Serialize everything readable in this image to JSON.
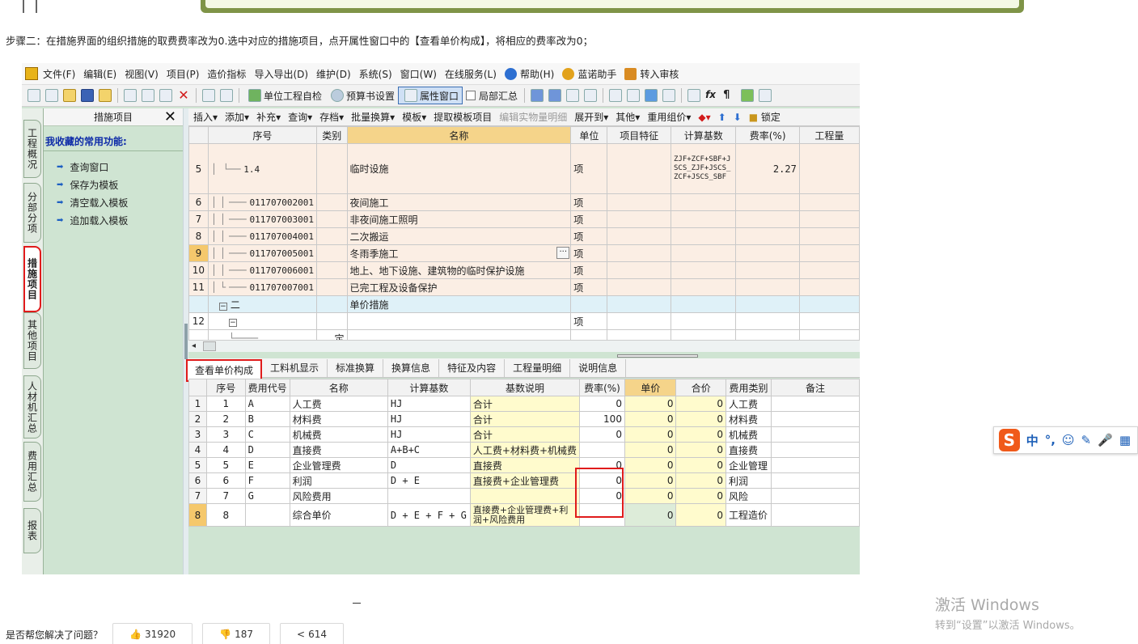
{
  "step_text": "步骤二：在措施界面的组织措施的取费费率改为0.选中对应的措施项目，点开属性窗口中的【查看单价构成】，将相应的费率改为0；",
  "menubar": [
    "文件(F)",
    "编辑(E)",
    "视图(V)",
    "项目(P)",
    "造价指标",
    "导入导出(D)",
    "维护(D)",
    "系统(S)",
    "窗口(W)",
    "在线服务(L)",
    "帮助(H)",
    "蓝诺助手",
    "转入审核"
  ],
  "toolbar": {
    "self_check": "单位工程自检",
    "budget_settings": "预算书设置",
    "property_window": "属性窗口",
    "partial_summary": "局部汇总"
  },
  "vertical_tabs": [
    "工程概况",
    "分部分项",
    "措施项目",
    "其他项目",
    "人材机汇总",
    "费用汇总",
    "报表"
  ],
  "favorites": {
    "header": "措施项目",
    "close": "✕",
    "title": "我收藏的常用功能:",
    "items": [
      "查询窗口",
      "保存为模板",
      "清空载入模板",
      "追加载入模板"
    ]
  },
  "main_toolbar": [
    "插入▾",
    "添加▾",
    "补充▾",
    "查询▾",
    "存档▾",
    "批量换算▾",
    "模板▾",
    "提取模板项目",
    "编辑实物量明细",
    "展开到▾",
    "其他▾",
    "重用组价▾",
    "锁定"
  ],
  "upper_table": {
    "headers": [
      "序号",
      "类别",
      "名称",
      "单位",
      "项目特征",
      "计算基数",
      "费率(%)",
      "工程量"
    ],
    "rows": [
      {
        "num": "5",
        "code": "1.4",
        "type": "",
        "name": "临时设施",
        "unit": "项",
        "feature": "",
        "base": "ZJF+ZCF+SBF+JSCS_ZJF+JSCS_ZCF+JSCS_SBF",
        "rate": "2.27",
        "qty": ""
      },
      {
        "num": "6",
        "code": "011707002001",
        "type": "",
        "name": "夜间施工",
        "unit": "项",
        "feature": "",
        "base": "",
        "rate": "",
        "qty": ""
      },
      {
        "num": "7",
        "code": "011707003001",
        "type": "",
        "name": "非夜间施工照明",
        "unit": "项",
        "feature": "",
        "base": "",
        "rate": "",
        "qty": ""
      },
      {
        "num": "8",
        "code": "011707004001",
        "type": "",
        "name": "二次搬运",
        "unit": "项",
        "feature": "",
        "base": "",
        "rate": "",
        "qty": ""
      },
      {
        "num": "9",
        "code": "011707005001",
        "type": "",
        "name": "冬雨季施工",
        "unit": "项",
        "feature": "",
        "base": "",
        "rate": "",
        "qty": ""
      },
      {
        "num": "10",
        "code": "011707006001",
        "type": "",
        "name": "地上、地下设施、建筑物的临时保护设施",
        "unit": "项",
        "feature": "",
        "base": "",
        "rate": "",
        "qty": ""
      },
      {
        "num": "11",
        "code": "011707007001",
        "type": "",
        "name": "已完工程及设备保护",
        "unit": "项",
        "feature": "",
        "base": "",
        "rate": "",
        "qty": ""
      },
      {
        "num": "",
        "code": "二",
        "type": "",
        "name": "单价措施",
        "unit": "",
        "feature": "",
        "base": "",
        "rate": "",
        "qty": ""
      },
      {
        "num": "12",
        "code": "",
        "type": "",
        "name": "",
        "unit": "项",
        "feature": "",
        "base": "",
        "rate": "",
        "qty": ""
      },
      {
        "num": "",
        "code": "",
        "type": "定",
        "name": "",
        "unit": "",
        "feature": "",
        "base": "",
        "rate": "",
        "qty": ""
      }
    ]
  },
  "lower_tabs": [
    "查看单价构成",
    "工料机显示",
    "标准换算",
    "换算信息",
    "特征及内容",
    "工程量明细",
    "说明信息"
  ],
  "lower_table": {
    "headers": [
      "序号",
      "费用代号",
      "名称",
      "计算基数",
      "基数说明",
      "费率(%)",
      "单价",
      "合价",
      "费用类别",
      "备注"
    ],
    "rows": [
      {
        "idx": "1",
        "seq": "1",
        "code": "A",
        "name": "人工费",
        "base": "HJ",
        "desc": "合计",
        "rate": "0",
        "price": "0",
        "total": "0",
        "category": "人工费",
        "note": ""
      },
      {
        "idx": "2",
        "seq": "2",
        "code": "B",
        "name": "材料费",
        "base": "HJ",
        "desc": "合计",
        "rate": "100",
        "price": "0",
        "total": "0",
        "category": "材料费",
        "note": ""
      },
      {
        "idx": "3",
        "seq": "3",
        "code": "C",
        "name": "机械费",
        "base": "HJ",
        "desc": "合计",
        "rate": "0",
        "price": "0",
        "total": "0",
        "category": "机械费",
        "note": ""
      },
      {
        "idx": "4",
        "seq": "4",
        "code": "D",
        "name": "直接费",
        "base": "A+B+C",
        "desc": "人工费+材料费+机械费",
        "rate": "",
        "price": "0",
        "total": "0",
        "category": "直接费",
        "note": ""
      },
      {
        "idx": "5",
        "seq": "5",
        "code": "E",
        "name": "企业管理费",
        "base": "D",
        "desc": "直接费",
        "rate": "0",
        "price": "0",
        "total": "0",
        "category": "企业管理",
        "note": ""
      },
      {
        "idx": "6",
        "seq": "6",
        "code": "F",
        "name": "利润",
        "base": "D + E",
        "desc": "直接费+企业管理费",
        "rate": "0",
        "price": "0",
        "total": "0",
        "category": "利润",
        "note": ""
      },
      {
        "idx": "7",
        "seq": "7",
        "code": "G",
        "name": "风险费用",
        "base": "",
        "desc": "",
        "rate": "0",
        "price": "0",
        "total": "0",
        "category": "风险",
        "note": ""
      },
      {
        "idx": "8",
        "seq": "8",
        "code": "",
        "name": "综合单价",
        "base": "D + E + F + G",
        "desc": "直接费+企业管理费+利润+风险费用",
        "rate": "",
        "price": "0",
        "total": "0",
        "category": "工程造价",
        "note": ""
      }
    ]
  },
  "ime": {
    "logo": "S",
    "items": [
      "中",
      "°,",
      "☺",
      "✎",
      "🎤",
      "▦"
    ]
  },
  "activate": {
    "title": "激活 Windows",
    "subtitle": "转到“设置”以激活 Windows。"
  },
  "feedback": {
    "question": "是否帮您解决了问题？",
    "like": "31920",
    "dislike": "187",
    "share": "614"
  },
  "colors": {
    "highlight_red": "#e01b1b",
    "selected_row": "#f5c86c",
    "panel_green": "#cfe4d2"
  }
}
